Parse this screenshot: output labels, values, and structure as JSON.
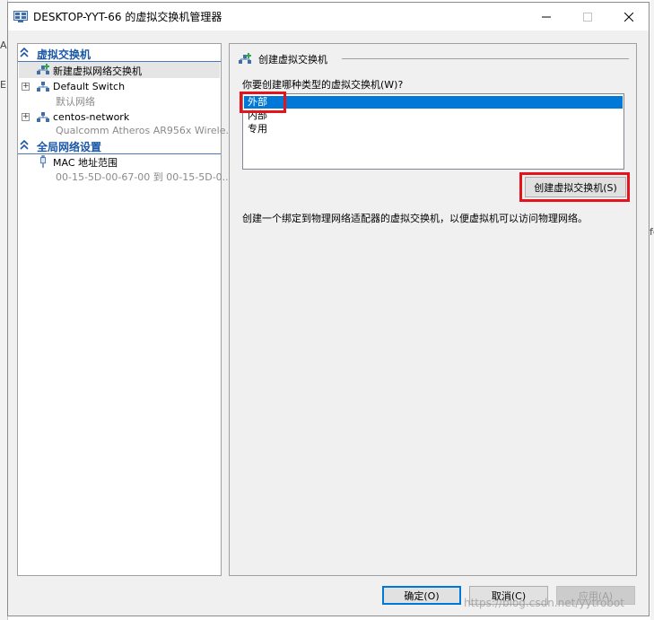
{
  "window": {
    "title": "DESKTOP-YYT-66 的虚拟交换机管理器",
    "controls": {
      "minimize": "minimize",
      "maximize": "maximize",
      "close": "close"
    }
  },
  "left_pane": {
    "sections": [
      {
        "title": "虚拟交换机",
        "items": [
          {
            "label": "新建虚拟网络交换机",
            "sub": "",
            "selected": true,
            "icon": "add-switch-icon"
          },
          {
            "label": "Default Switch",
            "sub": "默认网络",
            "selected": false,
            "icon": "network-switch-icon"
          },
          {
            "label": "centos-network",
            "sub": "Qualcomm Atheros AR956x Wirele...",
            "selected": false,
            "icon": "network-switch-icon"
          }
        ]
      },
      {
        "title": "全局网络设置",
        "items": [
          {
            "label": "MAC 地址范围",
            "sub": "00-15-5D-00-67-00 到 00-15-5D-0...",
            "selected": false,
            "icon": "mac-range-icon"
          }
        ]
      }
    ]
  },
  "right_pane": {
    "header": "创建虚拟交换机",
    "question": "你要创建哪种类型的虚拟交换机(W)?",
    "switch_types": [
      "外部",
      "内部",
      "专用"
    ],
    "selected_type": "外部",
    "create_button": "创建虚拟交换机(S)",
    "description": "创建一个绑定到物理网络适配器的虚拟交换机，以便虚拟机可以访问物理网络。"
  },
  "footer": {
    "ok": "确定(O)",
    "cancel": "取消(C)",
    "apply": "应用(A)"
  },
  "background": {
    "fragments": [
      "A",
      "E",
      "fe"
    ]
  },
  "watermark": "https://blog.csdn.net/yytrobot",
  "colors": {
    "selection": "#0078d7",
    "section_header": "#1a57a6",
    "highlight_box": "#e3141c"
  }
}
